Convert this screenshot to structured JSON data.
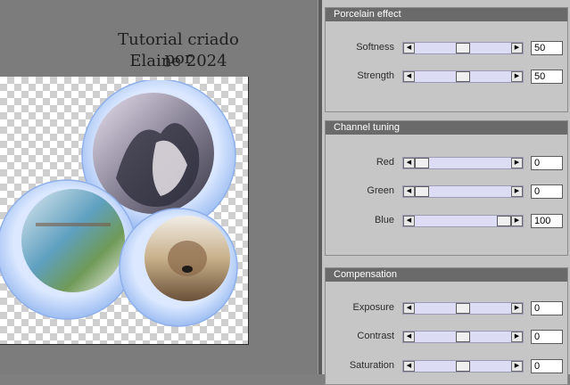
{
  "canvas": {
    "overlay_line1": "Tutorial criado por",
    "overlay_line2": "Elaine 2024"
  },
  "panel": {
    "groups": [
      {
        "title": "Porcelain effect",
        "params": [
          {
            "label": "Softness",
            "value": "50",
            "fraction": 0.5
          },
          {
            "label": "Strength",
            "value": "50",
            "fraction": 0.5
          }
        ]
      },
      {
        "title": "Channel tuning",
        "params": [
          {
            "label": "Red",
            "value": "0",
            "fraction": 0.0
          },
          {
            "label": "Green",
            "value": "0",
            "fraction": 0.0
          },
          {
            "label": "Blue",
            "value": "100",
            "fraction": 1.0
          }
        ]
      },
      {
        "title": "Compensation",
        "params": [
          {
            "label": "Exposure",
            "value": "0",
            "fraction": 0.5
          },
          {
            "label": "Contrast",
            "value": "0",
            "fraction": 0.5
          },
          {
            "label": "Saturation",
            "value": "0",
            "fraction": 0.5
          }
        ]
      }
    ]
  },
  "colors": {
    "group_header": "#6a6a6a",
    "slider_track": "#dcdcf4",
    "frame_ring": "#a8c8f8"
  },
  "icons": {
    "left_arrow": "left-arrow-icon",
    "right_arrow": "right-arrow-icon"
  }
}
